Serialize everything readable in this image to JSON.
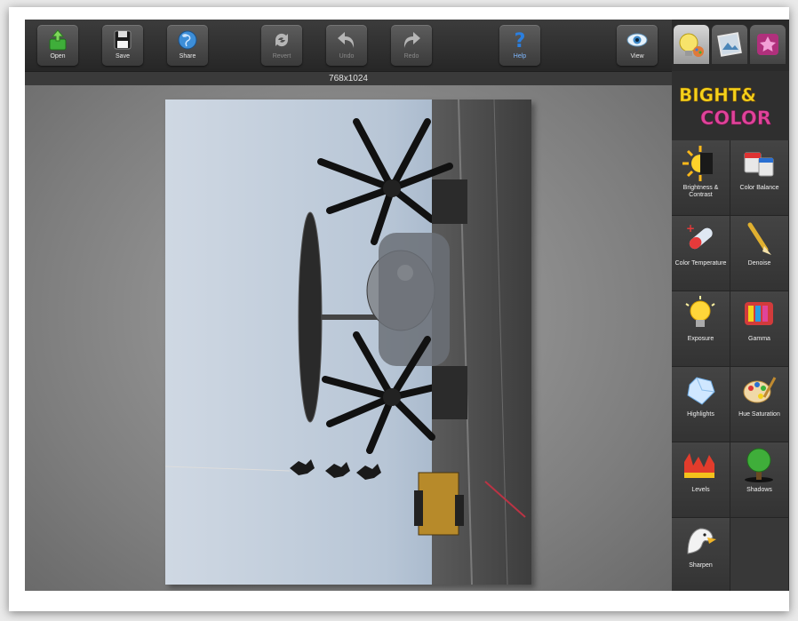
{
  "toolbar": {
    "open": "Open",
    "save": "Save",
    "share": "Share",
    "revert": "Revert",
    "undo": "Undo",
    "redo": "Redo",
    "help": "Help",
    "view": "View"
  },
  "image_size": "768x1024",
  "sidebar": {
    "tabs": [
      {
        "name": "light-color-tab",
        "active": true
      },
      {
        "name": "photo-tab",
        "active": false
      },
      {
        "name": "star-effects-tab",
        "active": false
      }
    ],
    "brand_line1": "BIGHT&",
    "brand_line2": "COLOR",
    "tools": [
      {
        "label": "Brightness & Contrast",
        "icon": "sun-half-icon"
      },
      {
        "label": "Color Balance",
        "icon": "paint-cans-icon"
      },
      {
        "label": "Color Temperature",
        "icon": "thermometer-icon"
      },
      {
        "label": "Denoise",
        "icon": "brush-icon"
      },
      {
        "label": "Exposure",
        "icon": "lightbulb-icon"
      },
      {
        "label": "Gamma",
        "icon": "color-bars-icon"
      },
      {
        "label": "Highlights",
        "icon": "diamond-icon"
      },
      {
        "label": "Hue Saturation",
        "icon": "palette-icon"
      },
      {
        "label": "Levels",
        "icon": "levels-chart-icon"
      },
      {
        "label": "Shadows",
        "icon": "tree-icon"
      },
      {
        "label": "Sharpen",
        "icon": "eagle-icon"
      }
    ]
  },
  "colors": {
    "accent_green": "#3fae3a",
    "help_blue": "#2a7fe0",
    "brand_yellow": "#f4d21c",
    "brand_pink": "#e0449a"
  }
}
